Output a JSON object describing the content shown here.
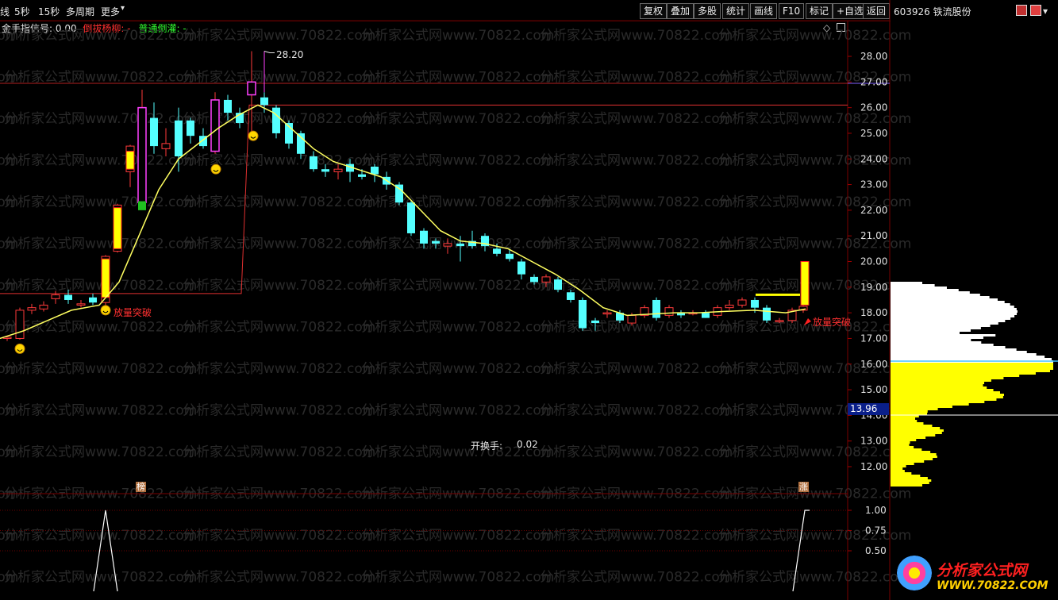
{
  "toolbar": {
    "left_items": [
      "线",
      "5秒",
      "15秒",
      "多周期",
      "更多"
    ],
    "right_buttons": [
      "复权",
      "叠加",
      "多股",
      "统计",
      "画线",
      "F10",
      "标记",
      "+自选",
      "返回"
    ]
  },
  "right_panel": {
    "stock_label": "603926 铁流股份",
    "price_marker": "13.96"
  },
  "indicator_header": {
    "name": "金手指信号:",
    "value": "0.00",
    "signal1": "倒拔杨柳:",
    "signal1_value": "-",
    "signal2": "普通倒灌:",
    "signal2_value": "-"
  },
  "price_axis": [
    "28.00",
    "27.00",
    "26.00",
    "25.00",
    "24.00",
    "23.00",
    "22.00",
    "21.00",
    "20.00",
    "19.00",
    "18.00",
    "17.00",
    "16.00",
    "15.00",
    "14.00",
    "13.00",
    "12.00"
  ],
  "indicator_axis": [
    "1.00",
    "0.75",
    "0.50"
  ],
  "annotations": {
    "peak_price": "28.20",
    "breakout_left": "放量突破",
    "breakout_right": "放量突破",
    "turnover_label": "开换手:",
    "turnover_value": "0.02",
    "tag_bang": "榜",
    "tag_zhang": "涨"
  },
  "watermark": "分析家公式网www.70822.com",
  "logo": {
    "title": "分析家公式网",
    "url": "WWW.70822.COM"
  },
  "colors": {
    "up": "#ff3a3a",
    "down": "#54ffff",
    "ma_line": "#ffff60",
    "signal_bar": "#ffff00",
    "stair_line": "#e03030",
    "magenta_bar": "#ff40ff",
    "volume_profile_top": "#ffffff",
    "volume_profile_bottom": "#ffff00"
  }
}
